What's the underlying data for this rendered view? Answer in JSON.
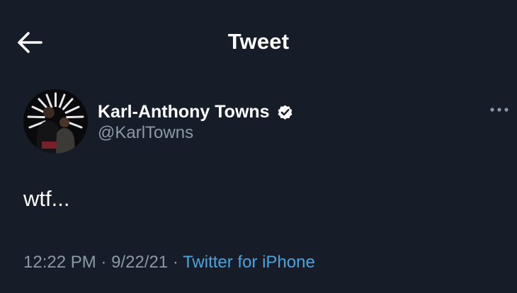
{
  "header": {
    "title": "Tweet",
    "back_icon": "arrow-left-icon"
  },
  "tweet": {
    "author": {
      "name": "Karl-Anthony Towns",
      "handle": "@KarlTowns",
      "verified": true,
      "verified_icon": "verified-badge-icon"
    },
    "text": "wtf...",
    "time": "12:22 PM",
    "separator": "·",
    "date": "9/22/21",
    "source": "Twitter for iPhone"
  },
  "menu": {
    "more_icon": "more-horizontal-icon"
  },
  "colors": {
    "background": "#161d28",
    "text_primary": "#ffffff",
    "text_secondary": "#8b98a5",
    "link": "#4aa3df"
  }
}
